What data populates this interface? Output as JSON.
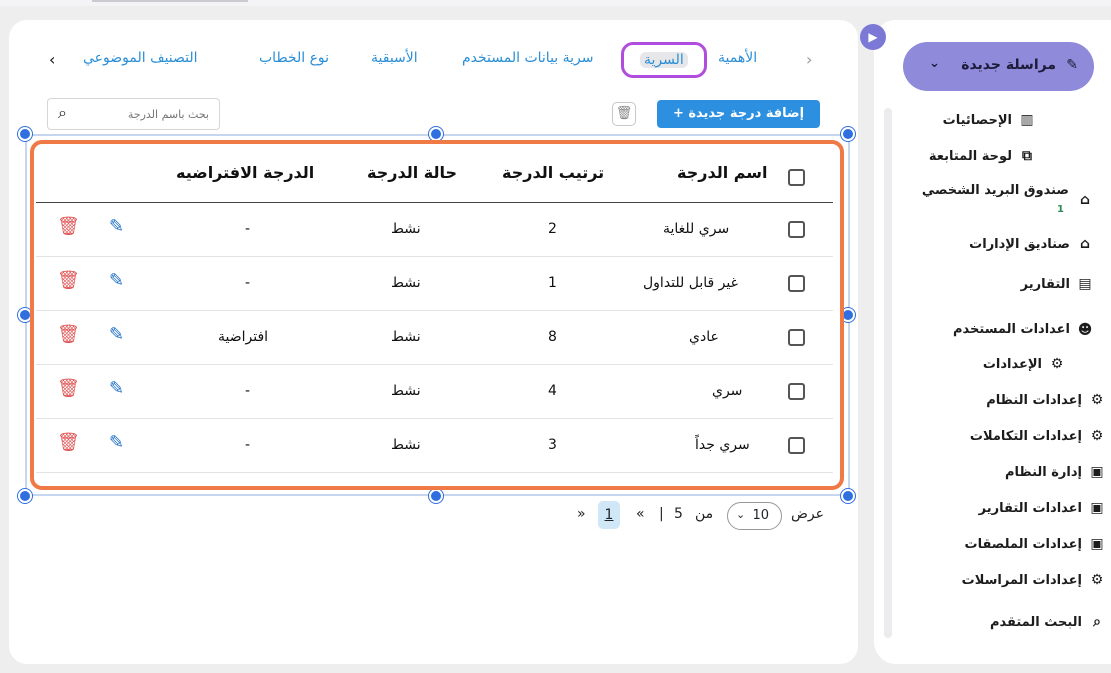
{
  "sidebar": {
    "compose_label": "مراسلة جديدة",
    "items": [
      {
        "label": "الإحصائيات",
        "icon": "bar-chart-icon"
      },
      {
        "label": "لوحة المتابعة",
        "icon": "monitor-icon"
      },
      {
        "label": "صندوق البريد الشخصي",
        "icon": "inbox-icon",
        "badge": "1"
      },
      {
        "label": "صناديق الإدارات",
        "icon": "inbox-icon"
      },
      {
        "label": "التقارير",
        "icon": "document-icon"
      },
      {
        "label": "اعدادات المستخدم",
        "icon": "user-gear-icon"
      },
      {
        "label": "الإعدادات",
        "icon": "gear-icon"
      },
      {
        "label": "إعدادات النظام",
        "icon": "gear-icon"
      },
      {
        "label": "إعدادات التكاملات",
        "icon": "gear-icon"
      },
      {
        "label": "إدارة النظام",
        "icon": "card-icon"
      },
      {
        "label": "اعدادات التقارير",
        "icon": "card-icon"
      },
      {
        "label": "إعدادات الملصقات",
        "icon": "card-icon"
      },
      {
        "label": "إعدادات المراسلات",
        "icon": "gear-icon"
      },
      {
        "label": "البحث المتقدم",
        "icon": "search-icon"
      }
    ]
  },
  "tabs": [
    "الأهمية",
    "السرية",
    "سرية بيانات المستخدم",
    "الأسبقية",
    "نوع الخطاب",
    "التصنيف الموضوعي"
  ],
  "active_tab": "السرية",
  "toolbar": {
    "add_label": "+ إضافة درجة جديدة",
    "search_placeholder": "بحث باسم الدرجة"
  },
  "table": {
    "headers": [
      "اسم الدرجة",
      "ترتيب الدرجة",
      "حالة الدرجة",
      "الدرجة الافتراضيه"
    ],
    "rows": [
      {
        "name": "سري للغاية",
        "order": "2",
        "status": "نشط",
        "default": "-"
      },
      {
        "name": "غير قابل للتداول",
        "order": "1",
        "status": "نشط",
        "default": "-"
      },
      {
        "name": "عادي",
        "order": "8",
        "status": "نشط",
        "default": "افتراضية"
      },
      {
        "name": "سري",
        "order": "4",
        "status": "نشط",
        "default": "-"
      },
      {
        "name": "سري جداً",
        "order": "3",
        "status": "نشط",
        "default": "-"
      }
    ]
  },
  "pagination": {
    "show_label": "عرض",
    "page_size": "10",
    "of_label": "من",
    "total_pages": "5",
    "separator": "|",
    "prev": "«",
    "current": "1",
    "next": "»"
  },
  "colors": {
    "accent": "#2d8fe0",
    "compose": "#8f8ad9",
    "highlight": "#f07a45",
    "delete": "#e25757"
  }
}
